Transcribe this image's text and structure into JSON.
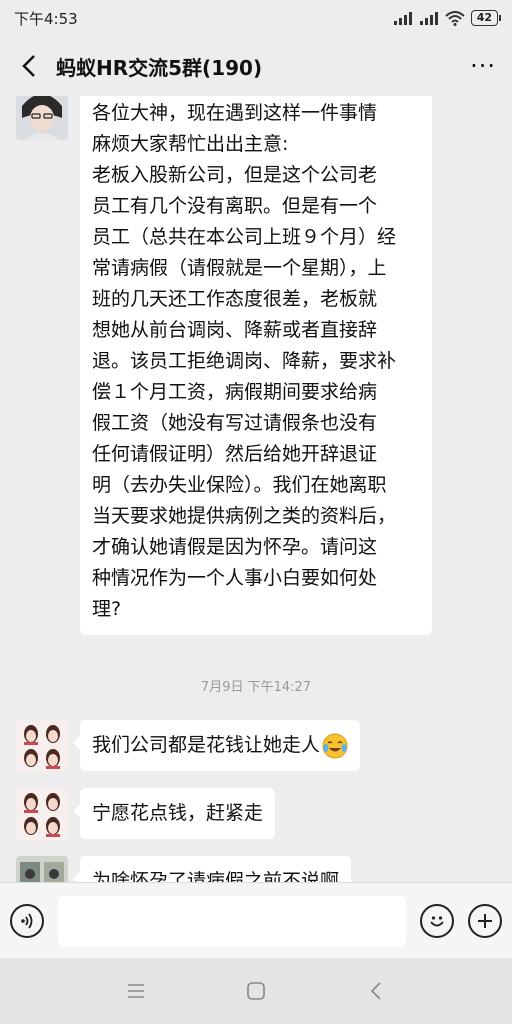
{
  "status_bar": {
    "time": "下午4:53",
    "battery": "42",
    "icons": [
      "signal-icon",
      "signal-icon",
      "wifi-icon",
      "battery-icon"
    ]
  },
  "header": {
    "back_icon": "chevron-left-icon",
    "title": "蚂蚁HR交流5群(190)",
    "more_icon": "more-dots-icon",
    "more_label": "···"
  },
  "messages": [
    {
      "lines": [
        "各位大神，现在遇到这样一件事情",
        "麻烦大家帮忙出出主意:",
        "老板入股新公司，但是这个公司老",
        "员工有几个没有离职。但是有一个",
        "员工（总共在本公司上班９个月）经",
        "常请病假（请假就是一个星期），上",
        "班的几天还工作态度很差，老板就",
        "想她从前台调岗、降薪或者直接辞",
        "退。该员工拒绝调岗、降薪，要求补",
        "偿１个月工资，病假期间要求给病",
        "假工资（她没有写过请假条也没有",
        "任何请假证明）然后给她开辞退证",
        "明（去办失业保险）。我们在她离职",
        "当天要求她提供病例之类的资料后，",
        "才确认她请假是因为怀孕。请问这",
        "种情况作为一个人事小白要如何处",
        "理?"
      ]
    },
    {
      "text": "我们公司都是花钱让她走人",
      "emoji": "crying-laughing-emoji-icon"
    },
    {
      "text": "宁愿花点钱，赶紧走"
    },
    {
      "text": "为啥怀孕了请病假之前不说啊"
    }
  ],
  "timestamp": "7月9日 下午14:27",
  "input_bar": {
    "voice_icon": "voice-icon",
    "input_value": "",
    "emoji_icon": "emoji-icon",
    "plus_icon": "plus-icon"
  },
  "nav_bar": {
    "icons": [
      "menu-icon",
      "home-icon",
      "back-icon"
    ]
  }
}
